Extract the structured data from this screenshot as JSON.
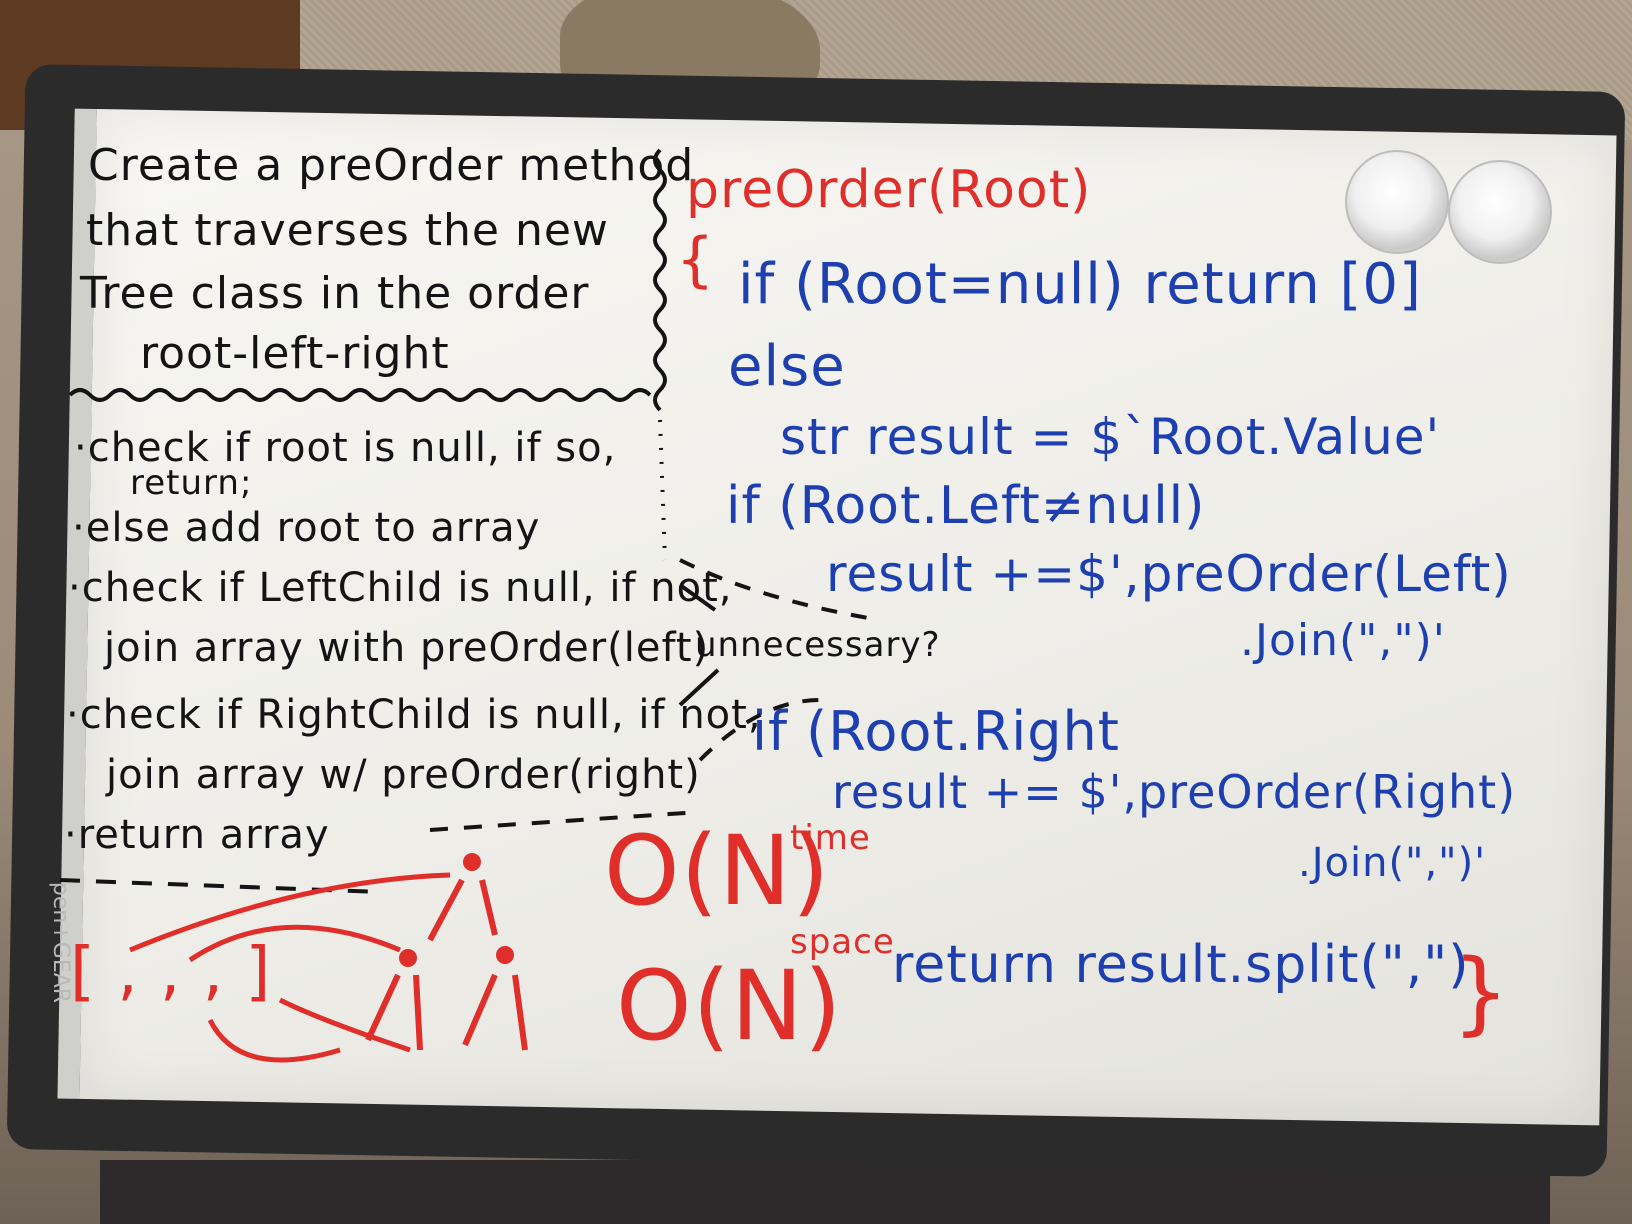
{
  "problem": {
    "line1": "Create a preOrder method",
    "line2": "that traverses the new",
    "line3": "Tree class in the order",
    "line4": "root-left-right"
  },
  "steps": {
    "s1a": "·check if root is null, if so,",
    "s1b": "return;",
    "s2": "·else add root to array",
    "s3a": "·check if LeftChild is null, if not,",
    "s3b": "join array with preOrder(left)",
    "s4a": "·check if RightChild is null, if not,",
    "s4b": "join array w/ preOrder(right)",
    "s5": "·return array"
  },
  "note": "unnecessary?",
  "code": {
    "signature": "preOrder(Root)",
    "open_brace": "{",
    "l1": "if (Root=null) return [0]",
    "l2": "else",
    "l3": "str result = $`Root.Value'",
    "l4": "if (Root.Left≠null)",
    "l5": "result +=$',preOrder(Left)",
    "l6": ".Join(\",\")'",
    "l7": "if (Root.Right",
    "l8": "result += $',preOrder(Right)",
    "l9": ".Join(\",\")'",
    "l10": "return result.split(\",\")",
    "close_brace": "}"
  },
  "complexity": {
    "time": "O(N)",
    "time_label": "time",
    "space": "O(N)",
    "space_label": "space"
  },
  "diagram": {
    "array_text": "[ ,  ,  ,  ]"
  },
  "brand": "pen+GEAR",
  "colors": {
    "black_marker": "#141414",
    "red_marker": "#e02f2a",
    "blue_marker": "#1d3fb0",
    "board": "#f4f3ef",
    "frame": "#2b2b2b"
  }
}
